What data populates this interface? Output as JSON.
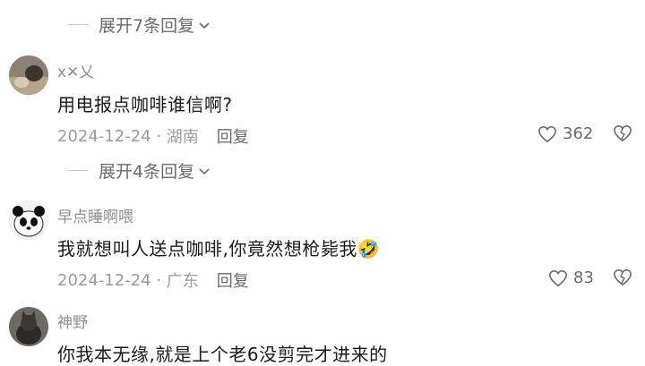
{
  "thread": {
    "expand_7": "展开7条回复",
    "expand_4": "展开4条回复"
  },
  "comments": [
    {
      "username": "x✕乂",
      "text": "用电报点咖啡谁信啊?",
      "date": "2024-12-24",
      "location": "湖南",
      "reply_label": "回复",
      "likes": "362"
    },
    {
      "username": "早点睡啊喂",
      "text": "我就想叫人送点咖啡,你竟然想枪毙我",
      "emoji": "🤣",
      "date": "2024-12-24",
      "location": "广东",
      "reply_label": "回复",
      "likes": "83"
    },
    {
      "username": "神野",
      "text": "你我本无缘,就是上个老6没剪完才进来的"
    }
  ],
  "colors": {
    "text_primary": "#1a1a1a",
    "text_secondary": "#9c9c9c",
    "username": "#8f8f8f",
    "divider": "#c8c8c8"
  }
}
